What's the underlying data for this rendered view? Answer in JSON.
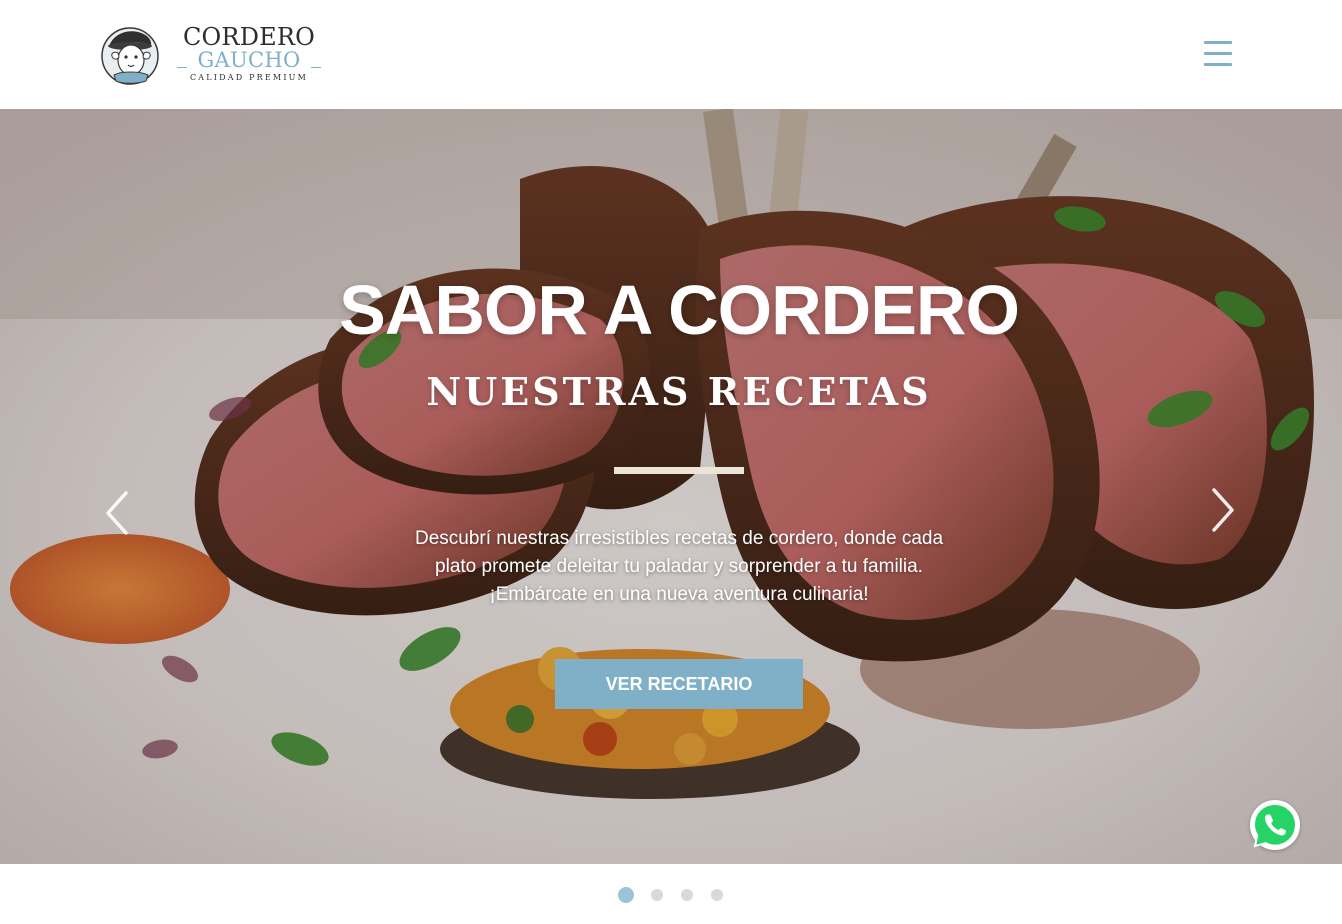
{
  "header": {
    "brand": {
      "line1": "CORDERO",
      "line2": "GAUCHO",
      "tagline": "CALIDAD PREMIUM"
    },
    "menu_icon": "hamburger-icon"
  },
  "hero": {
    "title": "SABOR A CORDERO",
    "subtitle": "NUESTRAS RECETAS",
    "description": [
      "Descubrí nuestras irresistibles recetas de cordero, donde cada",
      "plato promete deleitar tu paladar y sorprender a tu familia.",
      "¡Embárcate en una nueva aventura culinaria!"
    ],
    "button_label": "VER RECETARIO",
    "prev_icon": "chevron-left-icon",
    "next_icon": "chevron-right-icon"
  },
  "floating": {
    "whatsapp_icon": "whatsapp-icon"
  },
  "carousel": {
    "slide_count": 4,
    "active_slide": 1
  },
  "colors": {
    "accent": "#7fb0c8",
    "active_dot": "#9cc3d7",
    "inactive_dot": "#d9d9d9",
    "divider": "#ece4d6",
    "whatsapp_green": "#25d366",
    "text_dark": "#2d2d2d"
  }
}
